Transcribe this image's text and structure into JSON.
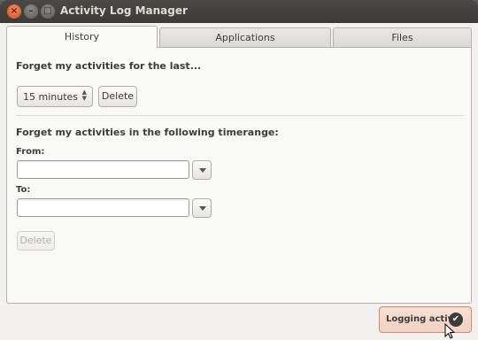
{
  "window": {
    "title": "Activity Log Manager",
    "close_glyph": "×",
    "minimize_glyph": "–",
    "maximize_glyph": "□"
  },
  "tabs": [
    {
      "label": "History",
      "active": true
    },
    {
      "label": "Applications",
      "active": false
    },
    {
      "label": "Files",
      "active": false
    }
  ],
  "history": {
    "forget_last_heading": "Forget my activities for the last...",
    "duration_value": "15 minutes",
    "delete_label": "Delete",
    "timerange_heading": "Forget my activities in the following timerange:",
    "from_label": "From:",
    "from_value": "",
    "to_label": "To:",
    "to_value": "",
    "delete_range_label": "Delete"
  },
  "status": {
    "label": "Logging active",
    "check_glyph": "✔"
  },
  "colors": {
    "titlebar": "#3c3b37",
    "accent": "#df4a16",
    "status_bg": "#f6e0d5"
  }
}
